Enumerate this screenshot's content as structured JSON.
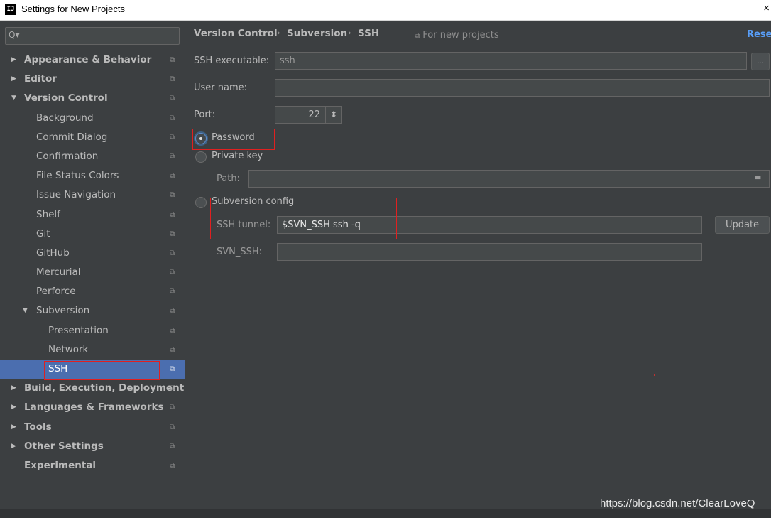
{
  "window": {
    "title": "Settings for New Projects",
    "logo_text": "IJ",
    "close_glyph": "×"
  },
  "search": {
    "icon": "Q▾",
    "placeholder": ""
  },
  "sidebar": {
    "items": [
      {
        "label": "Appearance & Behavior",
        "bold": true,
        "arrow": "▶",
        "level": 0
      },
      {
        "label": "Editor",
        "bold": true,
        "arrow": "▶",
        "level": 0
      },
      {
        "label": "Version Control",
        "bold": true,
        "arrow": "▼",
        "level": 0
      },
      {
        "label": "Background",
        "level": 1
      },
      {
        "label": "Commit Dialog",
        "level": 1
      },
      {
        "label": "Confirmation",
        "level": 1
      },
      {
        "label": "File Status Colors",
        "level": 1
      },
      {
        "label": "Issue Navigation",
        "level": 1
      },
      {
        "label": "Shelf",
        "level": 1
      },
      {
        "label": "Git",
        "level": 1
      },
      {
        "label": "GitHub",
        "level": 1
      },
      {
        "label": "Mercurial",
        "level": 1
      },
      {
        "label": "Perforce",
        "level": 1
      },
      {
        "label": "Subversion",
        "arrow": "▼",
        "level": 1
      },
      {
        "label": "Presentation",
        "level": 2
      },
      {
        "label": "Network",
        "level": 2
      },
      {
        "label": "SSH",
        "level": 2,
        "selected": true
      },
      {
        "label": "Build, Execution, Deployment",
        "bold": true,
        "arrow": "▶",
        "level": 0
      },
      {
        "label": "Languages & Frameworks",
        "bold": true,
        "arrow": "▶",
        "level": 0
      },
      {
        "label": "Tools",
        "bold": true,
        "arrow": "▶",
        "level": 0
      },
      {
        "label": "Other Settings",
        "bold": true,
        "arrow": "▶",
        "level": 0
      },
      {
        "label": "Experimental",
        "bold": true,
        "level": 0
      }
    ],
    "copy_icon": "⧉"
  },
  "breadcrumb": {
    "items": [
      "Version Control",
      "Subversion",
      "SSH"
    ],
    "separator": "›"
  },
  "scope_label": "For new projects",
  "scope_icon": "⧉",
  "reset_label": "Reset",
  "form": {
    "ssh_executable_label": "SSH executable:",
    "ssh_executable_value": "ssh",
    "browse_label": "...",
    "user_name_label": "User name:",
    "user_name_value": "",
    "port_label": "Port:",
    "port_value": "22",
    "spinner_glyph": "⬍",
    "auth_password_label": "Password",
    "auth_private_key_label": "Private key",
    "path_label": "Path:",
    "path_value": "",
    "folder_icon": "▬",
    "subversion_config_label": "Subversion config",
    "ssh_tunnel_label": "SSH tunnel:",
    "ssh_tunnel_value": "$SVN_SSH ssh -q",
    "update_label": "Update",
    "svn_ssh_label": "SVN_SSH:",
    "svn_ssh_value": ""
  },
  "watermark": "https://blog.csdn.net/ClearLoveQ",
  "colors": {
    "bg": "#3c3f41",
    "selection": "#4b6eaf",
    "link": "#589df6",
    "highlight": "#e02020"
  }
}
